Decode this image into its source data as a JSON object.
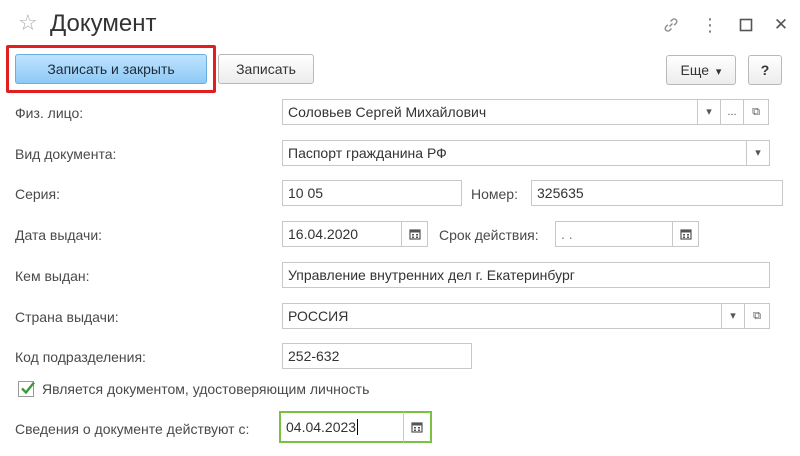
{
  "window": {
    "title": "Документ",
    "star_glyph": "☆",
    "link_glyph": "🔗",
    "more_glyph": "⋮",
    "maximize_glyph": "☐",
    "close_glyph": "✕"
  },
  "toolbar": {
    "save_close_label": "Записать и закрыть",
    "save_label": "Записать",
    "more_label": "Еще",
    "more_arrow": "▾",
    "help_label": "?"
  },
  "form": {
    "person": {
      "label": "Физ. лицо:",
      "value": "Соловьев Сергей Михайлович",
      "dropdown": "▾",
      "select": "...",
      "open": "⧉"
    },
    "doc_type": {
      "label": "Вид документа:",
      "value": "Паспорт гражданина РФ",
      "dropdown": "▾"
    },
    "series": {
      "label": "Серия:",
      "value": "10 05"
    },
    "number": {
      "label": "Номер:",
      "value": "325635"
    },
    "issue_date": {
      "label": "Дата выдачи:",
      "value": "16.04.2020"
    },
    "validity": {
      "label": "Срок действия:",
      "value": " .  ."
    },
    "issued_by": {
      "label": "Кем выдан:",
      "value": "Управление внутренних дел г. Екатеринбург"
    },
    "country": {
      "label": "Страна выдачи:",
      "value": "РОССИЯ",
      "dropdown": "▾",
      "open": "⧉"
    },
    "dept_code": {
      "label": "Код подразделения:",
      "value": "252-632"
    },
    "is_identity": {
      "label": "Является документом, удостоверяющим личность",
      "checked": true
    },
    "valid_from": {
      "label": "Сведения о документе действуют с:",
      "value": "04.04.2023"
    }
  },
  "colors": {
    "highlight_red": "#e02020",
    "focus_green": "#7ac142",
    "primary_button": "#8ecaf5",
    "check_green": "#3a9a3a"
  }
}
